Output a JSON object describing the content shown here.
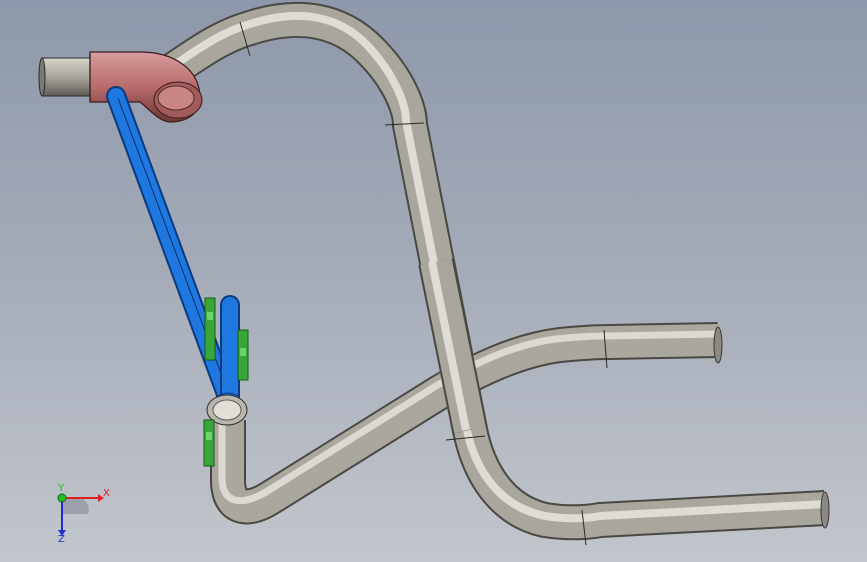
{
  "view": {
    "name": "cad-3d-view",
    "colors": {
      "background_top": "#8e98aa",
      "background_bottom": "#c2c6cc",
      "pipe_main": "#b9b6ad",
      "elbow": "#b86b6b",
      "bracket": "#1e78e0",
      "clamp": "#3aa63a"
    }
  },
  "triad": {
    "x_label": "X",
    "y_label": "Y",
    "z_label": "Z",
    "colors": {
      "x": "#e02020",
      "y": "#20c020",
      "z": "#2030d0"
    }
  }
}
